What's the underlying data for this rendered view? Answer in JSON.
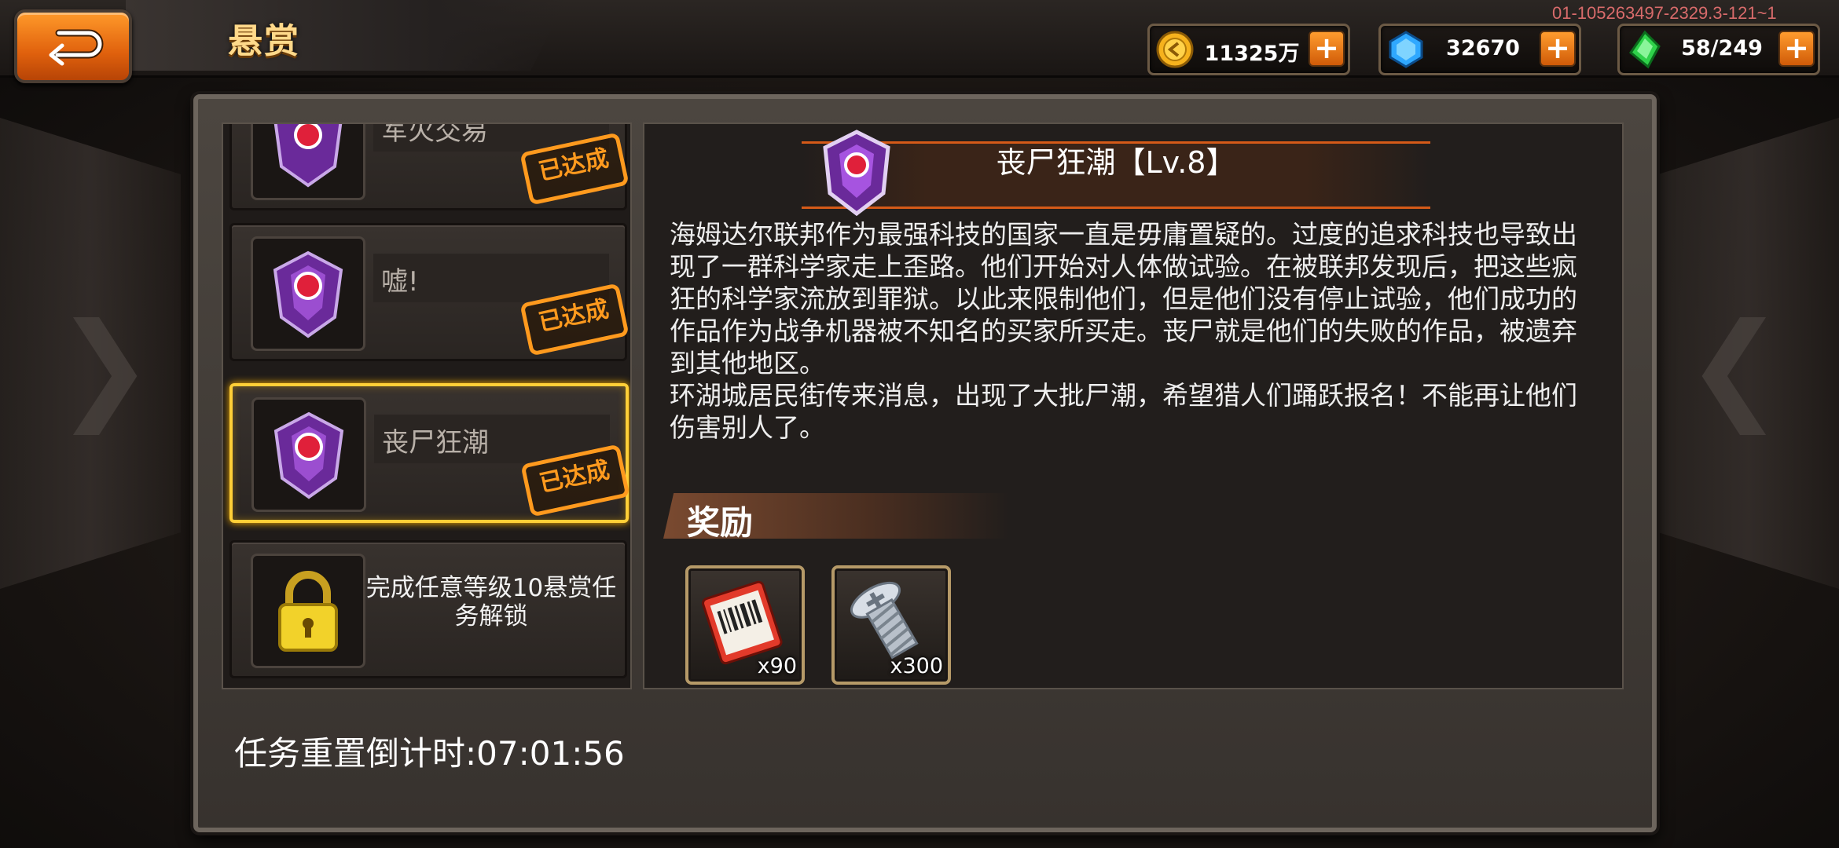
{
  "header": {
    "title": "悬赏",
    "build_id": "01-105263497-2329.3-121~1"
  },
  "resources": [
    {
      "icon": "gold-coin-icon",
      "value": "11325万"
    },
    {
      "icon": "blue-diamond-icon",
      "value": "32670"
    },
    {
      "icon": "green-energy-icon",
      "value": "58/249"
    }
  ],
  "bounties": [
    {
      "name": "军火交易",
      "status": "已达成"
    },
    {
      "name": "嘘!",
      "status": "已达成"
    },
    {
      "name": "丧尸狂潮",
      "status": "已达成"
    },
    {
      "locked_text": "完成任意等级10悬赏任务解锁"
    }
  ],
  "detail": {
    "title": "丧尸狂潮【Lv.8】",
    "description": "海姆达尔联邦作为最强科技的国家一直是毋庸置疑的。过度的追求科技也导致出现了一群科学家走上歪路。他们开始对人体做试验。在被联邦发现后，把这些疯狂的科学家流放到罪狱。以此来限制他们，但是他们没有停止试验，他们成功的作品作为战争机器被不知名的买家所买走。丧尸就是他们的失败的作品，被遗弃到其他地区。\n环湖城居民街传来消息，出现了大批尸潮，希望猎人们踊跃报名！不能再让他们伤害别人了。",
    "reward_label": "奖励",
    "rewards": [
      {
        "icon": "ticket-icon",
        "qty": "x90"
      },
      {
        "icon": "screw-icon",
        "qty": "x300"
      }
    ]
  },
  "footer": {
    "reset_countdown": "任务重置倒计时:07:01:56"
  },
  "colors": {
    "accent_orange": "#ff9a1e",
    "selected_gold": "#ffcf37"
  }
}
